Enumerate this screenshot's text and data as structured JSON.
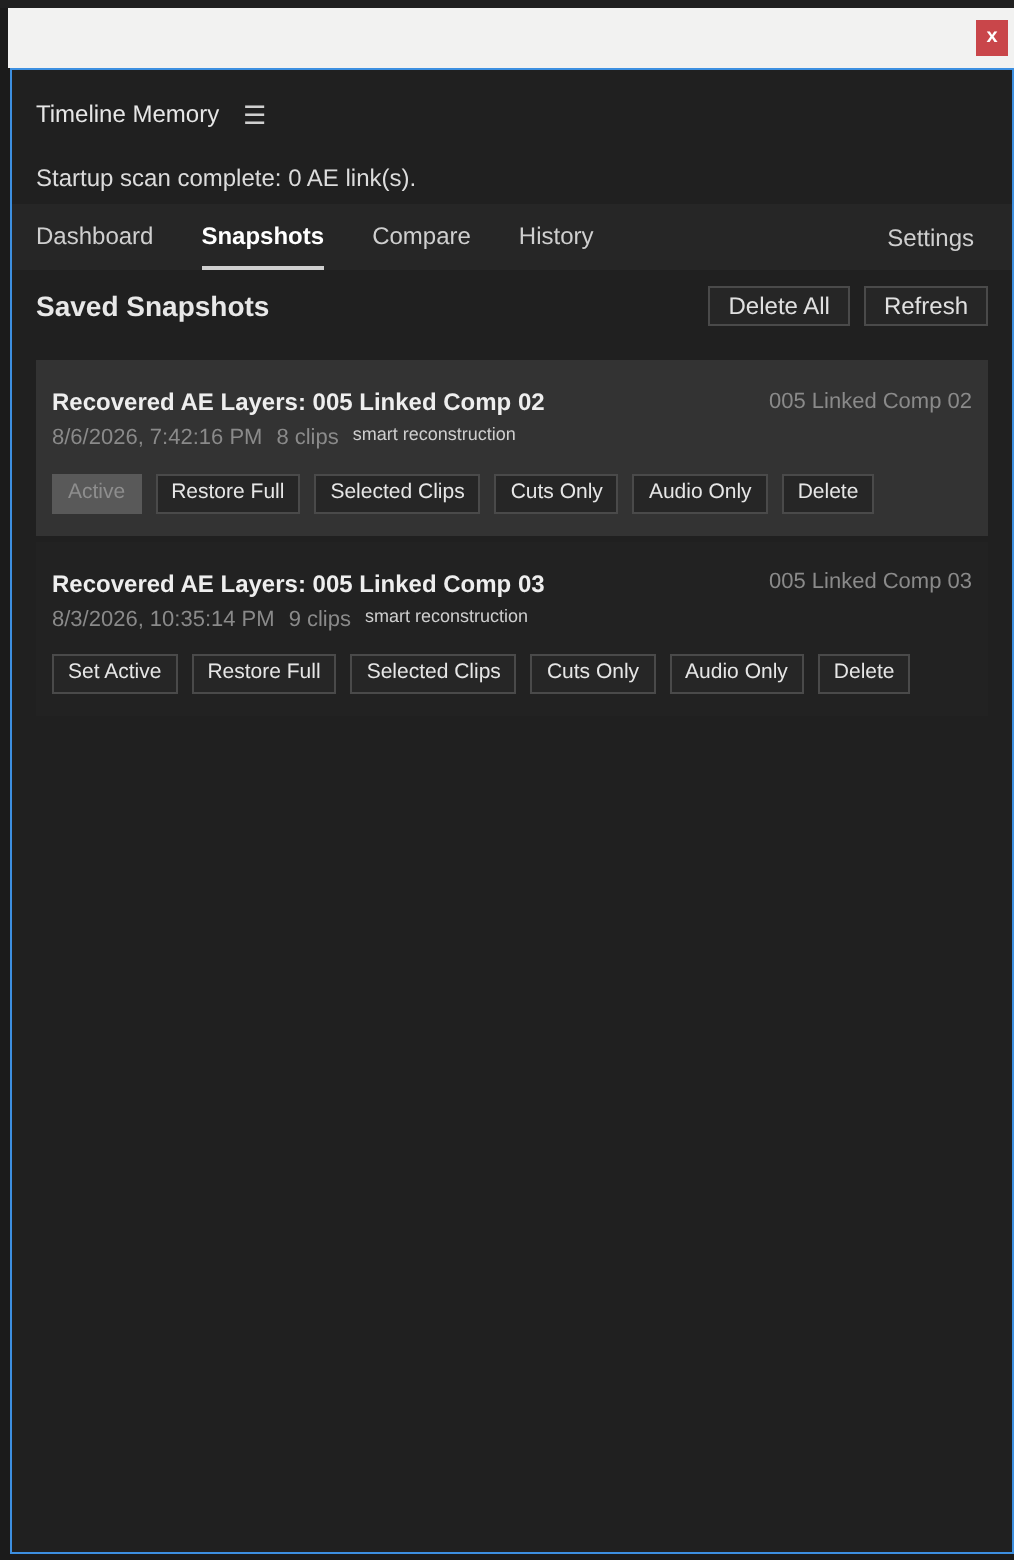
{
  "window": {
    "close": "x"
  },
  "panel": {
    "title": "Timeline Memory",
    "menu": "☰",
    "status": "Startup scan complete: 0 AE link(s)."
  },
  "tabs": [
    {
      "label": "Dashboard",
      "selected": false
    },
    {
      "label": "Snapshots",
      "selected": true
    },
    {
      "label": "Compare",
      "selected": false
    },
    {
      "label": "History",
      "selected": false
    }
  ],
  "settings": "Settings",
  "section": {
    "title": "Saved Snapshots",
    "actions": [
      "Delete All",
      "Refresh"
    ]
  },
  "snapshots": [
    {
      "title": "Recovered AE Layers: 005 Linked Comp 02",
      "comp": "005 Linked Comp 02",
      "date": "8/6/2026, 7:42:16 PM",
      "clips": "8 clips",
      "mode": "smart reconstruction",
      "active": true,
      "buttons": [
        {
          "label": "Active",
          "disabled": true
        },
        {
          "label": "Restore Full",
          "disabled": false
        },
        {
          "label": "Selected Clips",
          "disabled": false
        },
        {
          "label": "Cuts Only",
          "disabled": false
        },
        {
          "label": "Audio Only",
          "disabled": false
        },
        {
          "label": "Delete",
          "disabled": false
        }
      ]
    },
    {
      "title": "Recovered AE Layers: 005 Linked Comp 03",
      "comp": "005 Linked Comp 03",
      "date": "8/3/2026, 10:35:14 PM",
      "clips": "9 clips",
      "mode": "smart reconstruction",
      "active": false,
      "buttons": [
        {
          "label": "Set Active",
          "disabled": false
        },
        {
          "label": "Restore Full",
          "disabled": false
        },
        {
          "label": "Selected Clips",
          "disabled": false
        },
        {
          "label": "Cuts Only",
          "disabled": false
        },
        {
          "label": "Audio Only",
          "disabled": false
        },
        {
          "label": "Delete",
          "disabled": false
        }
      ]
    }
  ]
}
